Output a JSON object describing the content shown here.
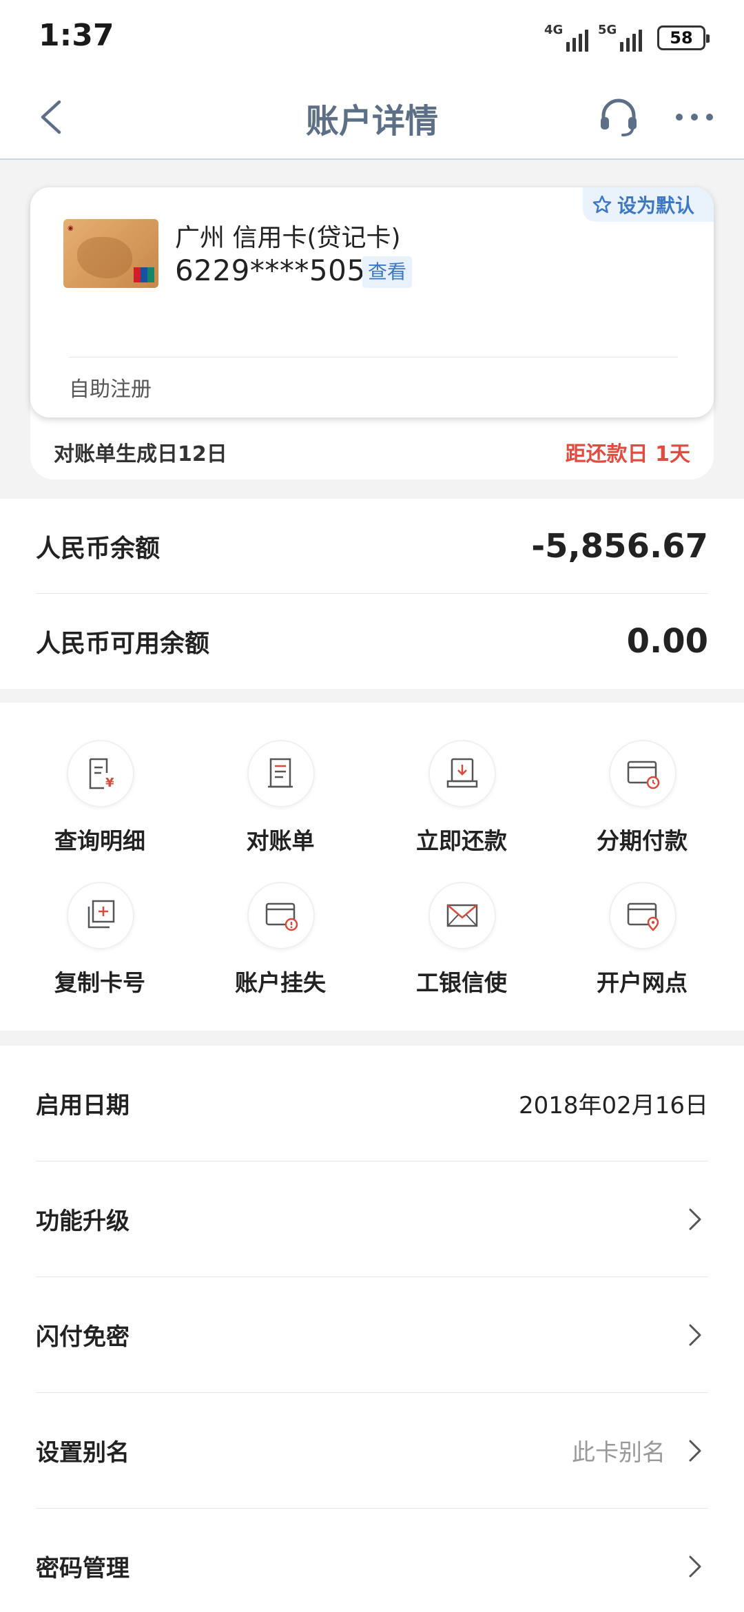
{
  "status_bar": {
    "time": "1:37",
    "signal1_label": "4G",
    "signal2_label": "5G",
    "battery": "58"
  },
  "header": {
    "title": "账户详情",
    "back_icon": "chevron-left-icon",
    "service_icon": "headset-icon",
    "more_icon": "more-dots-icon"
  },
  "card": {
    "default_label": "设为默认",
    "name": "广州 信用卡(贷记卡)",
    "number": "6229****5055",
    "view_label": "查看",
    "self_register": "自助注册",
    "statement_day": "对账单生成日12日",
    "due_day": "距还款日 1天",
    "due_color": "#e24b3f"
  },
  "balances": [
    {
      "label": "人民币余额",
      "value": "-5,856.67"
    },
    {
      "label": "人民币可用余额",
      "value": "0.00"
    }
  ],
  "functions": [
    {
      "label": "查询明细",
      "icon": "detail-query-icon"
    },
    {
      "label": "对账单",
      "icon": "statement-icon"
    },
    {
      "label": "立即还款",
      "icon": "repay-icon"
    },
    {
      "label": "分期付款",
      "icon": "installment-icon"
    },
    {
      "label": "复制卡号",
      "icon": "copy-card-icon"
    },
    {
      "label": "账户挂失",
      "icon": "report-loss-icon"
    },
    {
      "label": "工银信使",
      "icon": "mail-icon"
    },
    {
      "label": "开户网点",
      "icon": "branch-location-icon"
    }
  ],
  "list": [
    {
      "label": "启用日期",
      "value": "2018年02月16日"
    },
    {
      "label": "功能升级"
    },
    {
      "label": "闪付免密"
    },
    {
      "label": "设置别名",
      "hint": "此卡别名"
    },
    {
      "label": "密码管理"
    }
  ],
  "colors": {
    "accent_blue": "#3c78c6",
    "title_gray": "#5c6f86",
    "icon_red": "#d94a3d"
  }
}
